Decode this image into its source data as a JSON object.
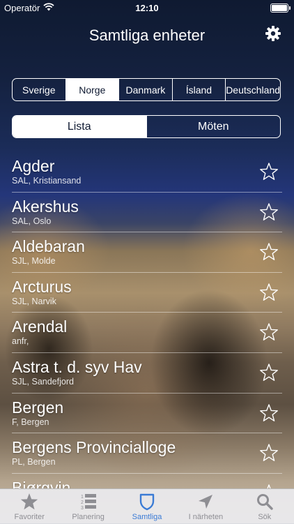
{
  "status_bar": {
    "carrier": "Operatör",
    "time": "12:10"
  },
  "nav": {
    "title": "Samtliga enheter"
  },
  "countries": [
    "Sverige",
    "Norge",
    "Danmark",
    "Ísland",
    "Deutschland"
  ],
  "selected_country": "Norge",
  "views": [
    "Lista",
    "Möten"
  ],
  "selected_view": "Lista",
  "units": [
    {
      "name": "Agder",
      "detail": "SAL, Kristiansand"
    },
    {
      "name": "Akershus",
      "detail": "SAL, Oslo"
    },
    {
      "name": "Aldebaran",
      "detail": "SJL, Molde"
    },
    {
      "name": "Arcturus",
      "detail": "SJL, Narvik"
    },
    {
      "name": "Arendal",
      "detail": "anfr,"
    },
    {
      "name": "Astra t. d. syv Hav",
      "detail": "SJL, Sandefjord"
    },
    {
      "name": "Bergen",
      "detail": "F, Bergen"
    },
    {
      "name": "Bergens Provincialloge",
      "detail": "PL, Bergen"
    },
    {
      "name": "Bjørgvin",
      "detail": ""
    }
  ],
  "tabs": [
    {
      "label": "Favoriter",
      "icon": "star-icon"
    },
    {
      "label": "Planering",
      "icon": "list-icon"
    },
    {
      "label": "Samtliga",
      "icon": "shield-icon"
    },
    {
      "label": "I närheten",
      "icon": "location-arrow-icon"
    },
    {
      "label": "Sök",
      "icon": "search-icon"
    }
  ],
  "active_tab": "Samtliga",
  "colors": {
    "active_tab": "#3a7bd5",
    "inactive_tab": "#8e8e93",
    "tab_bar_bg": "#ebebee"
  }
}
